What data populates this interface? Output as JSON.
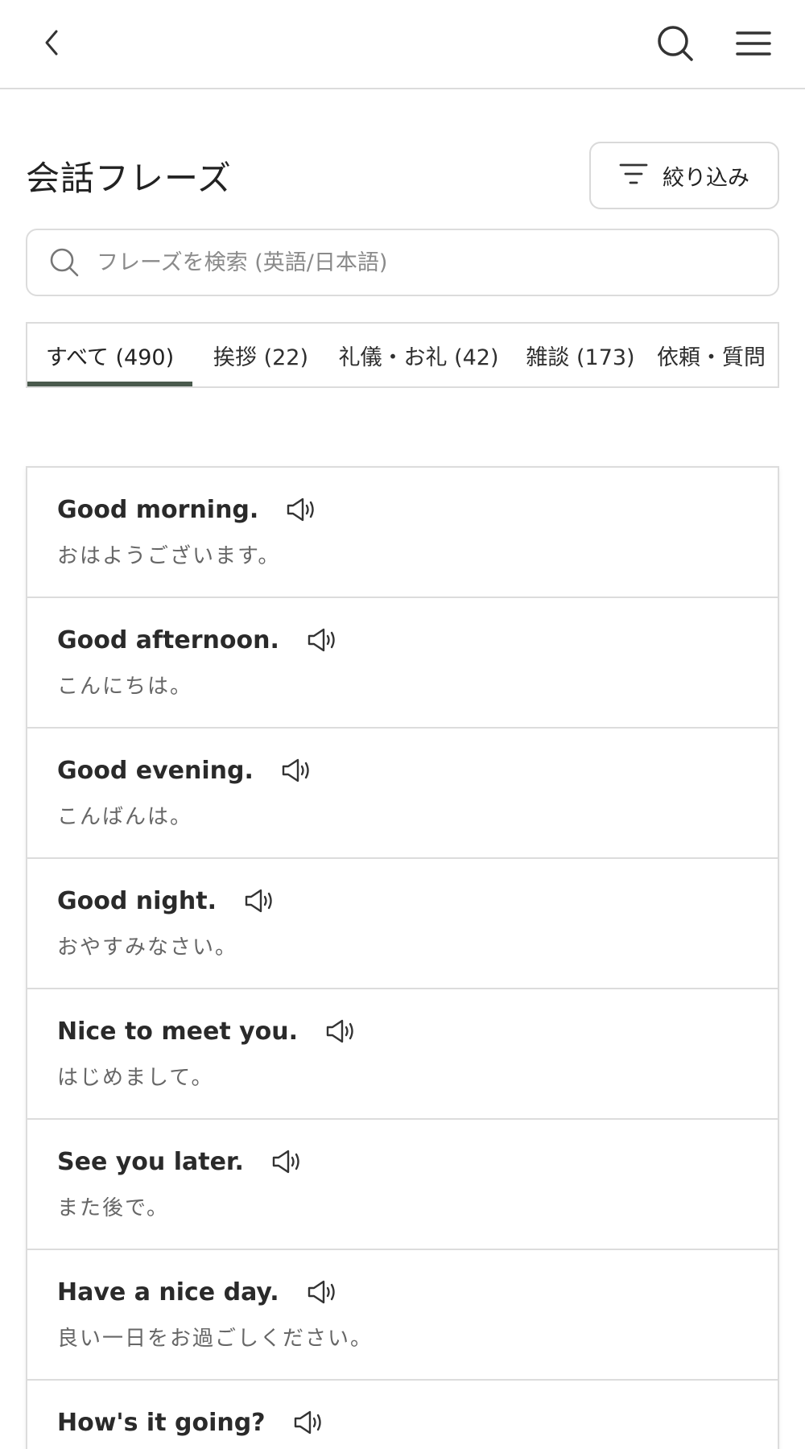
{
  "header": {
    "back_icon": "chevron-left-icon",
    "search_icon": "search-icon",
    "menu_icon": "hamburger-menu-icon"
  },
  "main": {
    "title": "会話フレーズ",
    "filter_label": "絞り込み",
    "search_placeholder": "フレーズを検索 (英語/日本語)",
    "tabs": [
      {
        "label": "すべて (490)",
        "active": true
      },
      {
        "label": "挨拶 (22)",
        "active": false
      },
      {
        "label": "礼儀・お礼 (42)",
        "active": false
      },
      {
        "label": "雑談 (173)",
        "active": false
      },
      {
        "label": "依頼・質問",
        "active": false
      }
    ],
    "phrases": [
      {
        "en": "Good morning.",
        "ja": "おはようございます。"
      },
      {
        "en": "Good afternoon.",
        "ja": "こんにちは。"
      },
      {
        "en": "Good evening.",
        "ja": "こんばんは。"
      },
      {
        "en": "Good night.",
        "ja": "おやすみなさい。"
      },
      {
        "en": "Nice to meet you.",
        "ja": "はじめまして。"
      },
      {
        "en": "See you later.",
        "ja": "また後で。"
      },
      {
        "en": "Have a nice day.",
        "ja": "良い一日をお過ごしください。"
      },
      {
        "en": "How's it going?",
        "ja": ""
      }
    ]
  },
  "colors": {
    "accent": "#4a5a4d",
    "border": "#dcdcdc",
    "text_secondary": "#666666"
  }
}
